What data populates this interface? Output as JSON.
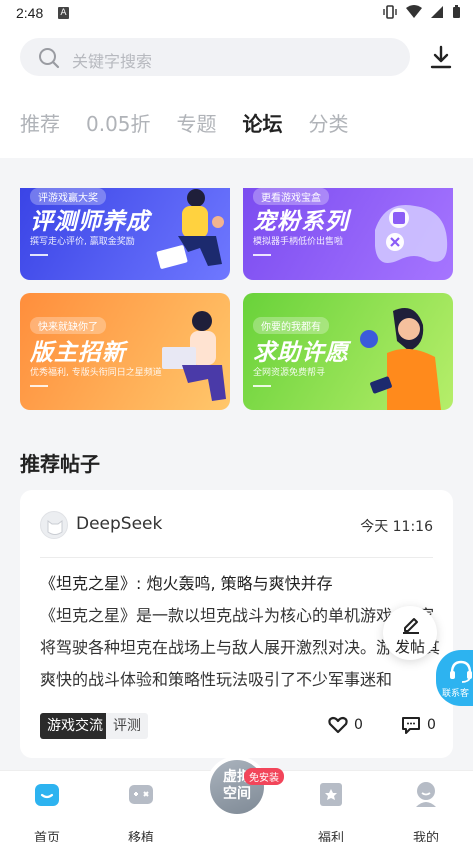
{
  "status_bar": {
    "time": "2:48"
  },
  "search": {
    "placeholder": "关键字搜索"
  },
  "tabs": [
    {
      "label": "推荐",
      "active": false
    },
    {
      "label": "0.05折",
      "active": false
    },
    {
      "label": "专题",
      "active": false
    },
    {
      "label": "论坛",
      "active": true
    },
    {
      "label": "分类",
      "active": false
    }
  ],
  "banners": [
    {
      "tag": "评游戏赢大奖",
      "title": "评测师养成",
      "sub": "撰写走心评价, 赢取金奖励"
    },
    {
      "tag": "更看游戏宝盒",
      "title": "宠粉系列",
      "sub": "模拟器手柄低价出售啦"
    },
    {
      "tag": "快来就缺你了",
      "title": "版主招新",
      "sub": "优秀福利, 专版头衔同日之星频道"
    },
    {
      "tag": "你要的我都有",
      "title": "求助许愿",
      "sub": "全网资源免费帮寻"
    }
  ],
  "section": {
    "title": "推荐帖子"
  },
  "post": {
    "author": "DeepSeek",
    "time": "今天 11:16",
    "title": "《坦克之星》: 炮火轰鸣, 策略与爽快并存",
    "body": "《坦克之星》是一款以坦克战斗为核心的单机游戏, 玩家将驾驶各种坦克在战场上与敌人展开激烈对决。游戏以其爽快的战斗体验和策略性玩法吸引了不少军事迷和",
    "tags": [
      "游戏交流",
      "评测"
    ],
    "likes": "0",
    "comments": "0"
  },
  "fab": {
    "label": "发帖"
  },
  "service": {
    "label": "联系客"
  },
  "nav": {
    "items": [
      {
        "label": "首页",
        "icon": "home-icon"
      },
      {
        "label": "移植",
        "icon": "gamepad-icon"
      },
      {
        "label": "福利",
        "icon": "gift-book-icon"
      },
      {
        "label": "我的",
        "icon": "profile-icon"
      }
    ],
    "center": {
      "label": "虚拟空间",
      "badge": "免安装"
    }
  },
  "colors": {
    "accent": "#2db3f0",
    "banner_blue": "#4a55ee",
    "banner_purple": "#8b5cf6",
    "banner_orange": "#ffa94d",
    "banner_green": "#8fdc4a"
  }
}
